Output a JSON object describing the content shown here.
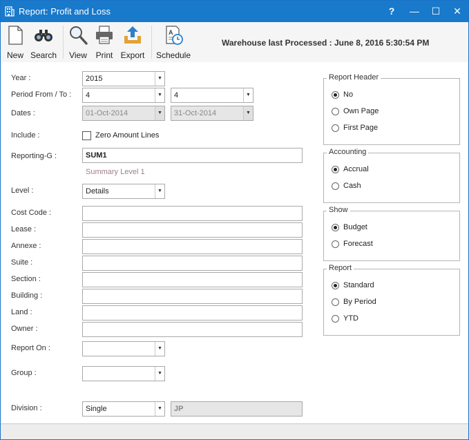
{
  "window": {
    "title": "Report: Profit and Loss",
    "controls": {
      "help": "?",
      "minimize": "—",
      "maximize": "☐",
      "close": "✕"
    }
  },
  "toolbar": {
    "buttons": [
      {
        "label": "New",
        "icon": "new-document-icon"
      },
      {
        "label": "Search",
        "icon": "binoculars-icon"
      },
      {
        "label": "View",
        "icon": "magnifier-icon"
      },
      {
        "label": "Print",
        "icon": "printer-icon"
      },
      {
        "label": "Export",
        "icon": "export-tray-icon"
      },
      {
        "label": "Schedule",
        "icon": "schedule-clock-icon"
      }
    ],
    "warehouse_status": "Warehouse last Processed : June 8, 2016 5:30:54 PM"
  },
  "form": {
    "year": {
      "label": "Year :",
      "value": "2015"
    },
    "period": {
      "label": "Period From / To :",
      "from": "4",
      "to": "4"
    },
    "dates": {
      "label": "Dates :",
      "from": "01-Oct-2014",
      "to": "31-Oct-2014"
    },
    "include": {
      "label": "Include :",
      "checkbox_label": "Zero Amount Lines",
      "checked": false
    },
    "reporting_group": {
      "label": "Reporting-G :",
      "value": "SUM1",
      "hint": "Summary Level 1"
    },
    "level": {
      "label": "Level :",
      "value": "Details"
    },
    "cost_code": {
      "label": "Cost Code :",
      "value": ""
    },
    "lease": {
      "label": "Lease :",
      "value": ""
    },
    "annexe": {
      "label": "Annexe :",
      "value": ""
    },
    "suite": {
      "label": "Suite :",
      "value": ""
    },
    "section": {
      "label": "Section :",
      "value": ""
    },
    "building": {
      "label": "Building :",
      "value": ""
    },
    "land": {
      "label": "Land :",
      "value": ""
    },
    "owner": {
      "label": "Owner :",
      "value": ""
    },
    "report_on": {
      "label": "Report On :",
      "value": ""
    },
    "group": {
      "label": "Group :",
      "value": ""
    },
    "division": {
      "label": "Division :",
      "value": "Single",
      "code": "JP"
    }
  },
  "options": {
    "report_header": {
      "title": "Report Header",
      "options": [
        "No",
        "Own Page",
        "First Page"
      ],
      "selected": 0
    },
    "accounting": {
      "title": "Accounting",
      "options": [
        "Accrual",
        "Cash"
      ],
      "selected": 0
    },
    "show": {
      "title": "Show",
      "options": [
        "Budget",
        "Forecast"
      ],
      "selected": 0
    },
    "report": {
      "title": "Report",
      "options": [
        "Standard",
        "By Period",
        "YTD"
      ],
      "selected": 0
    }
  }
}
